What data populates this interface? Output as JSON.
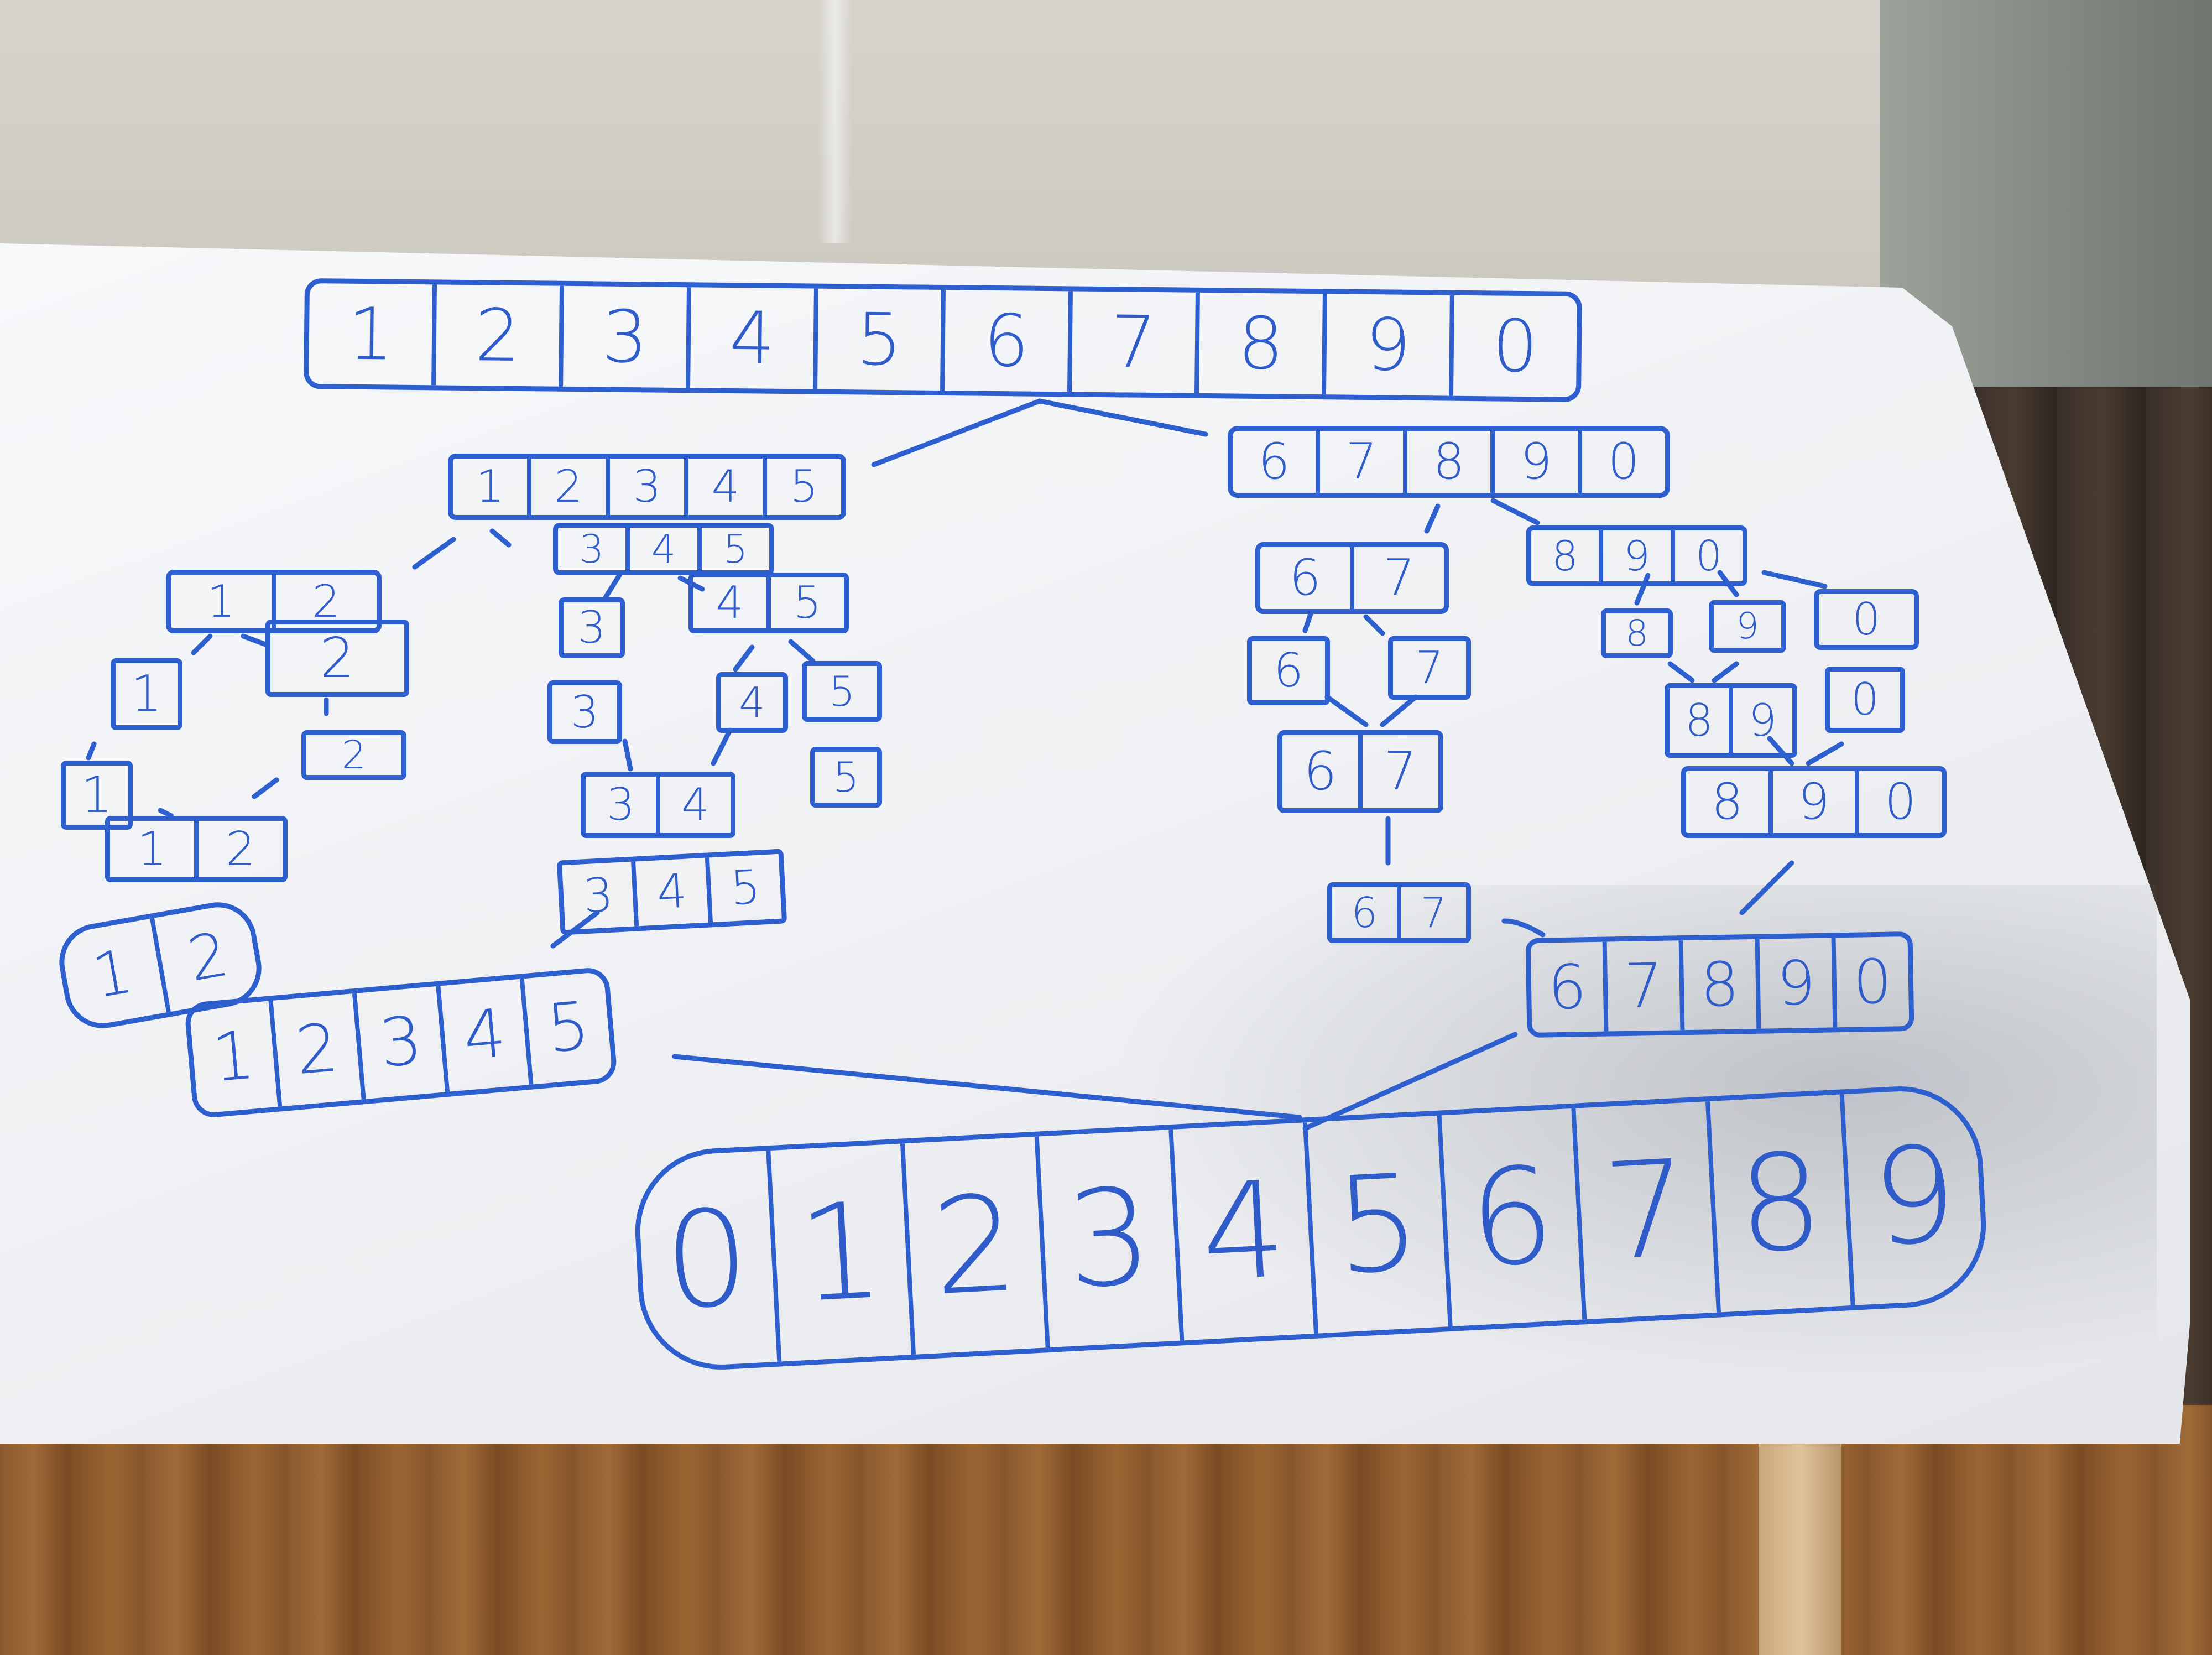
{
  "top_array": [
    "1",
    "2",
    "3",
    "4",
    "5",
    "6",
    "7",
    "8",
    "9",
    "0"
  ],
  "level1": {
    "left": [
      "1",
      "2",
      "3",
      "4",
      "5"
    ],
    "right": [
      "6",
      "7",
      "8",
      "9",
      "0"
    ]
  },
  "level2": {
    "a": [
      "1",
      "2"
    ],
    "b": [
      "3",
      "4",
      "5"
    ],
    "c": [
      "6",
      "7"
    ],
    "d": [
      "8",
      "9",
      "0"
    ]
  },
  "split_left": {
    "one": [
      "1"
    ],
    "two": [
      "2"
    ],
    "one_b": [
      "1"
    ],
    "two_b": [
      "2"
    ],
    "merge12a": [
      "1",
      "2"
    ],
    "merge12b": [
      "1",
      "2"
    ]
  },
  "split_mid": {
    "three": [
      "3"
    ],
    "fourfive": [
      "4",
      "5"
    ],
    "three_b": [
      "3"
    ],
    "four": [
      "4"
    ],
    "five": [
      "5"
    ],
    "five_b": [
      "5"
    ],
    "merge34": [
      "3",
      "4"
    ],
    "merge345": [
      "3",
      "4",
      "5"
    ]
  },
  "merge_left_final": [
    "1",
    "2",
    "3",
    "4",
    "5"
  ],
  "split_c": {
    "six": [
      "6"
    ],
    "seven": [
      "7"
    ],
    "merge67a": [
      "6",
      "7"
    ],
    "merge67b": [
      "6",
      "7"
    ]
  },
  "split_d": {
    "eight": [
      "8"
    ],
    "nine": [
      "9"
    ],
    "zero": [
      "0"
    ],
    "merge89": [
      "8",
      "9"
    ],
    "zero_b": [
      "0"
    ],
    "merge890": [
      "8",
      "9",
      "0"
    ]
  },
  "merge_right_final": [
    "6",
    "7",
    "8",
    "9",
    "0"
  ],
  "result": [
    "0",
    "1",
    "2",
    "3",
    "4",
    "5",
    "6",
    "7",
    "8",
    "9"
  ],
  "colors": {
    "marker": "#2e5fcf",
    "board": "#f2f3f6"
  }
}
